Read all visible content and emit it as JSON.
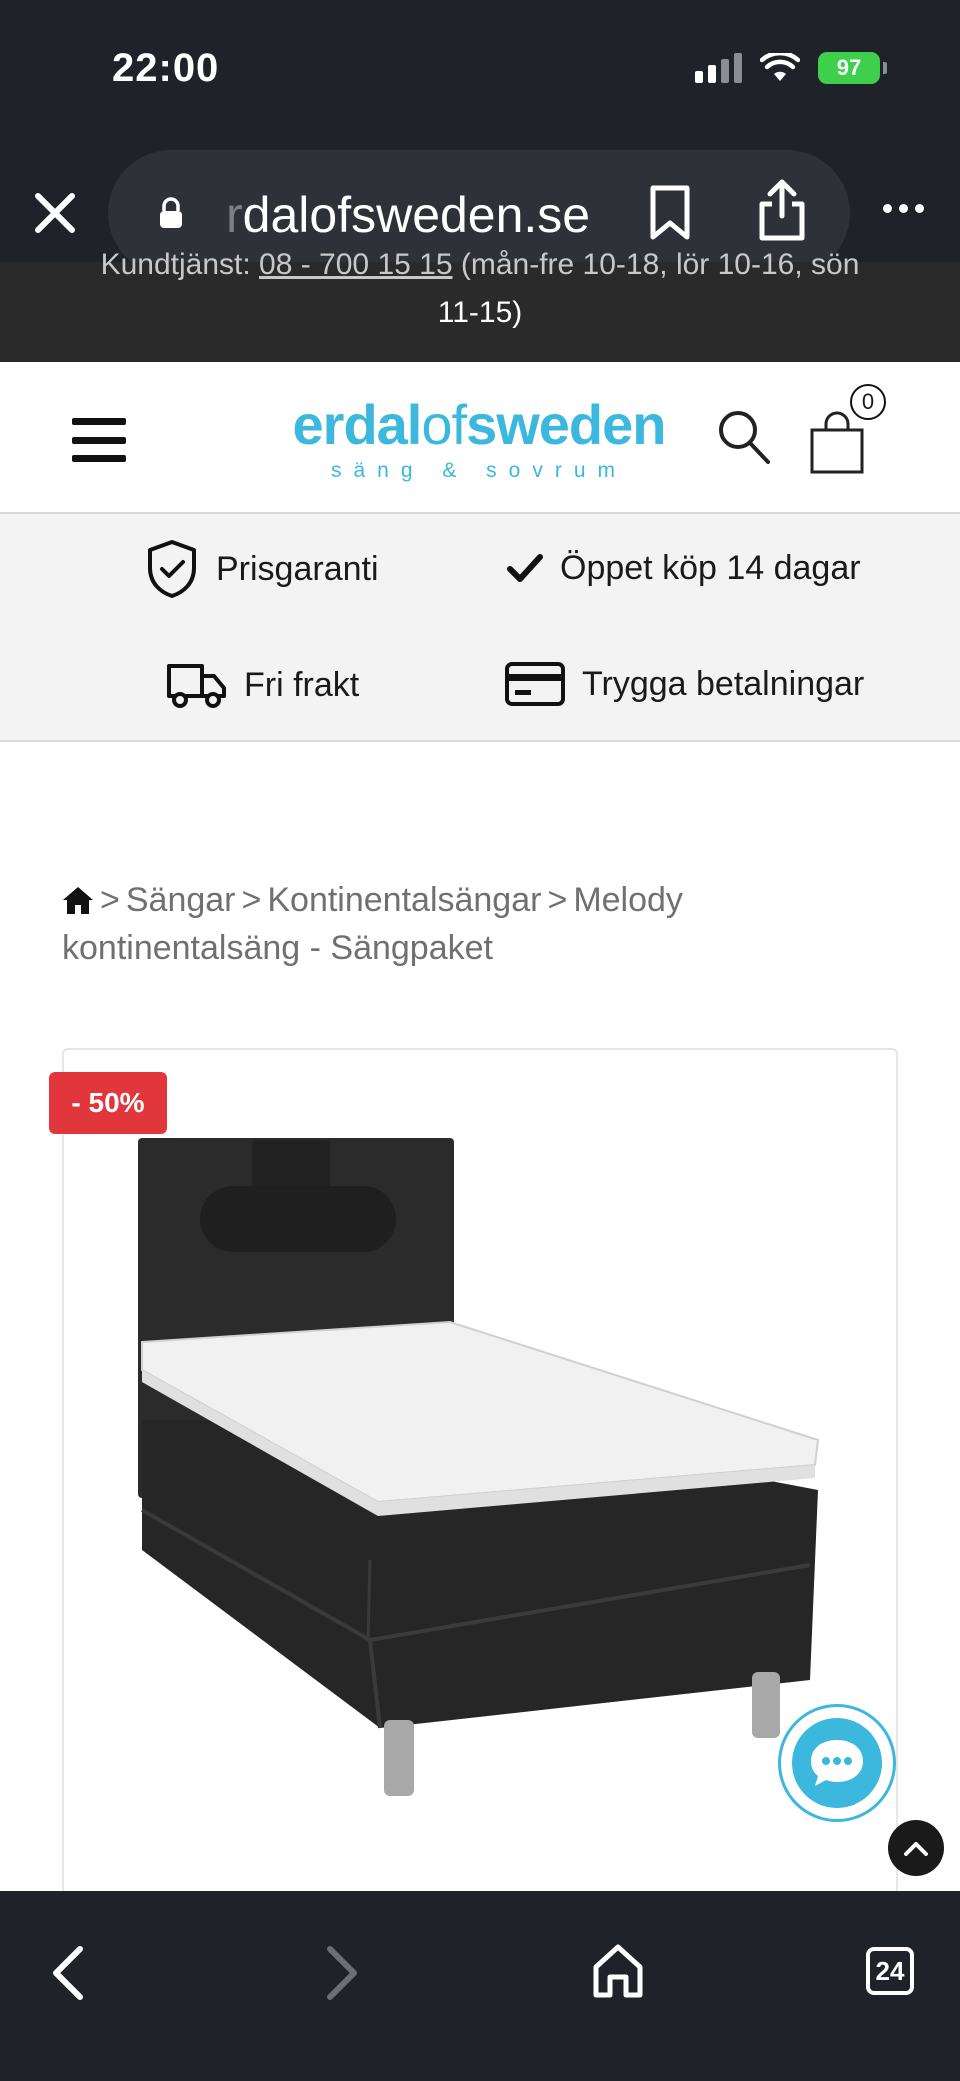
{
  "status_bar": {
    "time": "22:00",
    "battery": "97"
  },
  "browser": {
    "url_faded": "r",
    "url_main": "dalofsweden.se",
    "tab_count": "24"
  },
  "announcement": {
    "prefix": "Kundtjänst:",
    "phone": "08 - 700 15 15",
    "hours_line1": " (mån-fre 10-18, lör 10-16, sön",
    "hours_line2": "11-15)"
  },
  "header": {
    "logo_part1": "erdal",
    "logo_part2": "of",
    "logo_part3": "sweden",
    "logo_tagline": "säng & sovrum",
    "cart_count": "0"
  },
  "usp": [
    {
      "icon": "shield-check-icon",
      "label": "Prisgaranti"
    },
    {
      "icon": "checkmark-icon",
      "label": "Öppet köp 14 dagar"
    },
    {
      "icon": "truck-icon",
      "label": "Fri frakt"
    },
    {
      "icon": "credit-card-icon",
      "label": "Trygga betalningar"
    }
  ],
  "breadcrumb": {
    "items": [
      "Sängar",
      "Kontinentalsängar",
      "Melody kontinentalsäng - Sängpaket"
    ],
    "separator": ">"
  },
  "product": {
    "discount_badge": "- 50%"
  },
  "colors": {
    "brand": "#3cb7dd",
    "badge": "#e2363d",
    "chrome": "#1f2228"
  }
}
